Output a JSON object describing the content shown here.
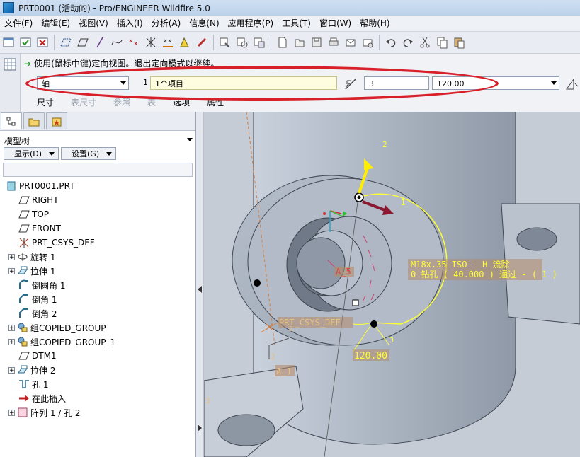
{
  "window": {
    "title": "PRT0001 (活动的) - Pro/ENGINEER Wildfire 5.0"
  },
  "menu": [
    "文件(F)",
    "编辑(E)",
    "视图(V)",
    "插入(I)",
    "分析(A)",
    "信息(N)",
    "应用程序(P)",
    "工具(T)",
    "窗口(W)",
    "帮助(H)"
  ],
  "toolbar_icons": [
    "new-window-icon",
    "open-window-icon",
    "close-window-icon",
    "datum-plane-icon",
    "plane-display-icon",
    "axis-display-icon",
    "curve-icon",
    "point-icon",
    "csys-icon",
    "spin-center-icon",
    "annotation-icon",
    "link-icon",
    "filter-icon",
    "repaint-icon",
    "orient-icon",
    "new-file-icon",
    "open-file-icon",
    "save-icon",
    "print-icon",
    "email-icon",
    "send-icon",
    "undo-icon",
    "redo-icon",
    "cut-icon",
    "copy-icon",
    "paste-icon"
  ],
  "dashboard": {
    "message": "使用(鼠标中键)定向视图。退出定向模式以继续。",
    "pattern_type": "轴",
    "count_label": "1",
    "ref_text": "1个项目",
    "member_count": "3",
    "angle": "120.00",
    "tabs": [
      {
        "label": "尺寸",
        "enabled": true
      },
      {
        "label": "表尺寸",
        "enabled": false
      },
      {
        "label": "参照",
        "enabled": false
      },
      {
        "label": "表",
        "enabled": false
      },
      {
        "label": "选项",
        "enabled": true
      },
      {
        "label": "属性",
        "enabled": true
      }
    ]
  },
  "model_tree": {
    "title": "模型树",
    "show_button": "显示(D)",
    "settings_button": "设置(G)",
    "items": [
      {
        "label": "PRT0001.PRT",
        "icon": "part-icon",
        "expander": false,
        "indent": 0
      },
      {
        "label": "RIGHT",
        "icon": "datum-plane-icon",
        "expander": false,
        "indent": 1
      },
      {
        "label": "TOP",
        "icon": "datum-plane-icon",
        "expander": false,
        "indent": 1
      },
      {
        "label": "FRONT",
        "icon": "datum-plane-icon",
        "expander": false,
        "indent": 1
      },
      {
        "label": "PRT_CSYS_DEF",
        "icon": "csys-icon",
        "expander": false,
        "indent": 1
      },
      {
        "label": "旋转 1",
        "icon": "revolve-icon",
        "expander": true,
        "indent": 1
      },
      {
        "label": "拉伸 1",
        "icon": "extrude-icon",
        "expander": true,
        "indent": 1
      },
      {
        "label": "倒圆角 1",
        "icon": "round-icon",
        "expander": false,
        "indent": 1
      },
      {
        "label": "倒角 1",
        "icon": "chamfer-icon",
        "expander": false,
        "indent": 1
      },
      {
        "label": "倒角 2",
        "icon": "chamfer-icon",
        "expander": false,
        "indent": 1
      },
      {
        "label": "组COPIED_GROUP",
        "icon": "group-icon",
        "expander": true,
        "indent": 1
      },
      {
        "label": "组COPIED_GROUP_1",
        "icon": "group-icon",
        "expander": true,
        "indent": 1
      },
      {
        "label": "DTM1",
        "icon": "datum-plane-icon",
        "expander": false,
        "indent": 1
      },
      {
        "label": "拉伸 2",
        "icon": "extrude-icon",
        "expander": true,
        "indent": 1
      },
      {
        "label": "孔 1",
        "icon": "hole-icon",
        "expander": false,
        "indent": 1
      },
      {
        "label": "在此插入",
        "icon": "insert-here-arrow-icon",
        "expander": false,
        "indent": 1
      },
      {
        "label": "阵列 1 / 孔 2",
        "icon": "pattern-icon",
        "expander": true,
        "indent": 1
      }
    ]
  },
  "viewport": {
    "hole_note_line1": "M18x.35 ISO - H 流除",
    "hole_note_line2": "0 钻孔 ( 40.000 ) 通过 - ( 1 )",
    "angle_dim": "120.00",
    "axis_tag_a5": "A_5",
    "axis_tag_a1": "A_1",
    "csys_label": "PRT_CSYS_DEF",
    "dir_labels": [
      "2",
      "1",
      "2",
      "3",
      "2",
      "3"
    ]
  },
  "colors": {
    "highlight": "#d8202a",
    "annotation": "#ffff33",
    "model": "#aeb8c4"
  }
}
